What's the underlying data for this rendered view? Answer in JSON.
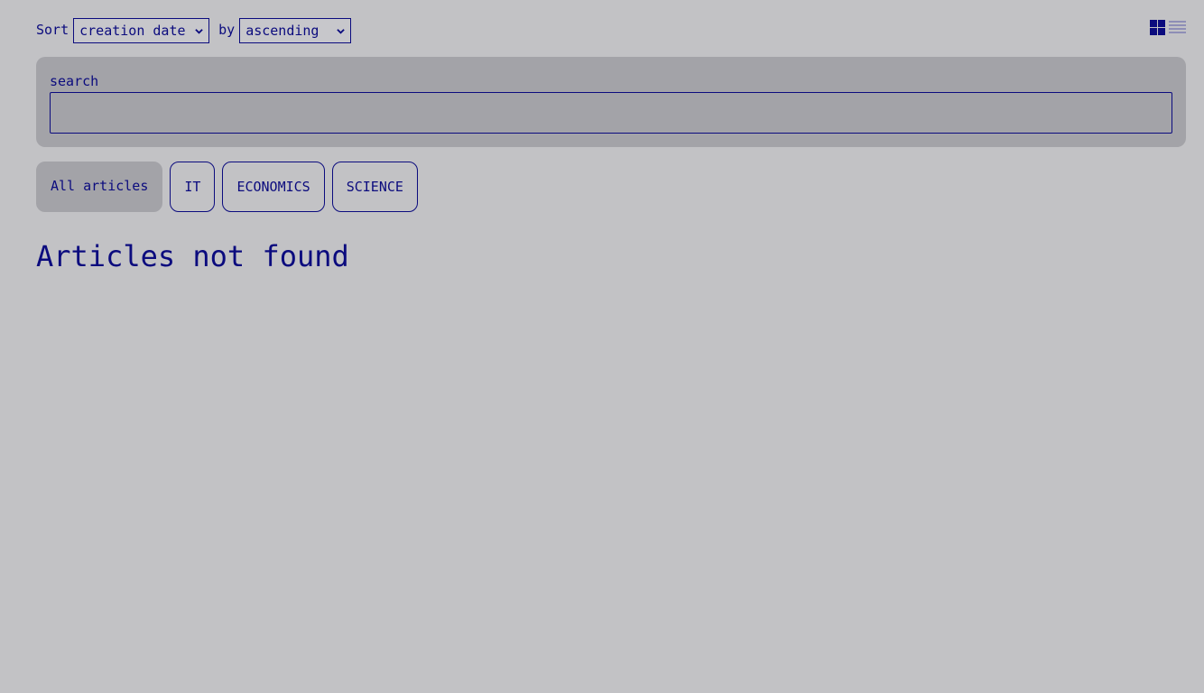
{
  "sort": {
    "label": "Sort",
    "field_value": "creation date",
    "by_label": "by",
    "order_value": "ascending"
  },
  "view_toggle": {
    "grid_icon": "grid-view-icon",
    "list_icon": "list-view-icon"
  },
  "search": {
    "label": "search",
    "value": "",
    "placeholder": ""
  },
  "categories": {
    "items": [
      {
        "label": "All articles",
        "active": true
      },
      {
        "label": "IT",
        "active": false
      },
      {
        "label": "ECONOMICS",
        "active": false
      },
      {
        "label": "SCIENCE",
        "active": false
      }
    ]
  },
  "results": {
    "empty_message": "Articles not found"
  },
  "colors": {
    "background": "#c2c2c5",
    "panel": "#a3a3a8",
    "accent": "#0b0b7e"
  }
}
